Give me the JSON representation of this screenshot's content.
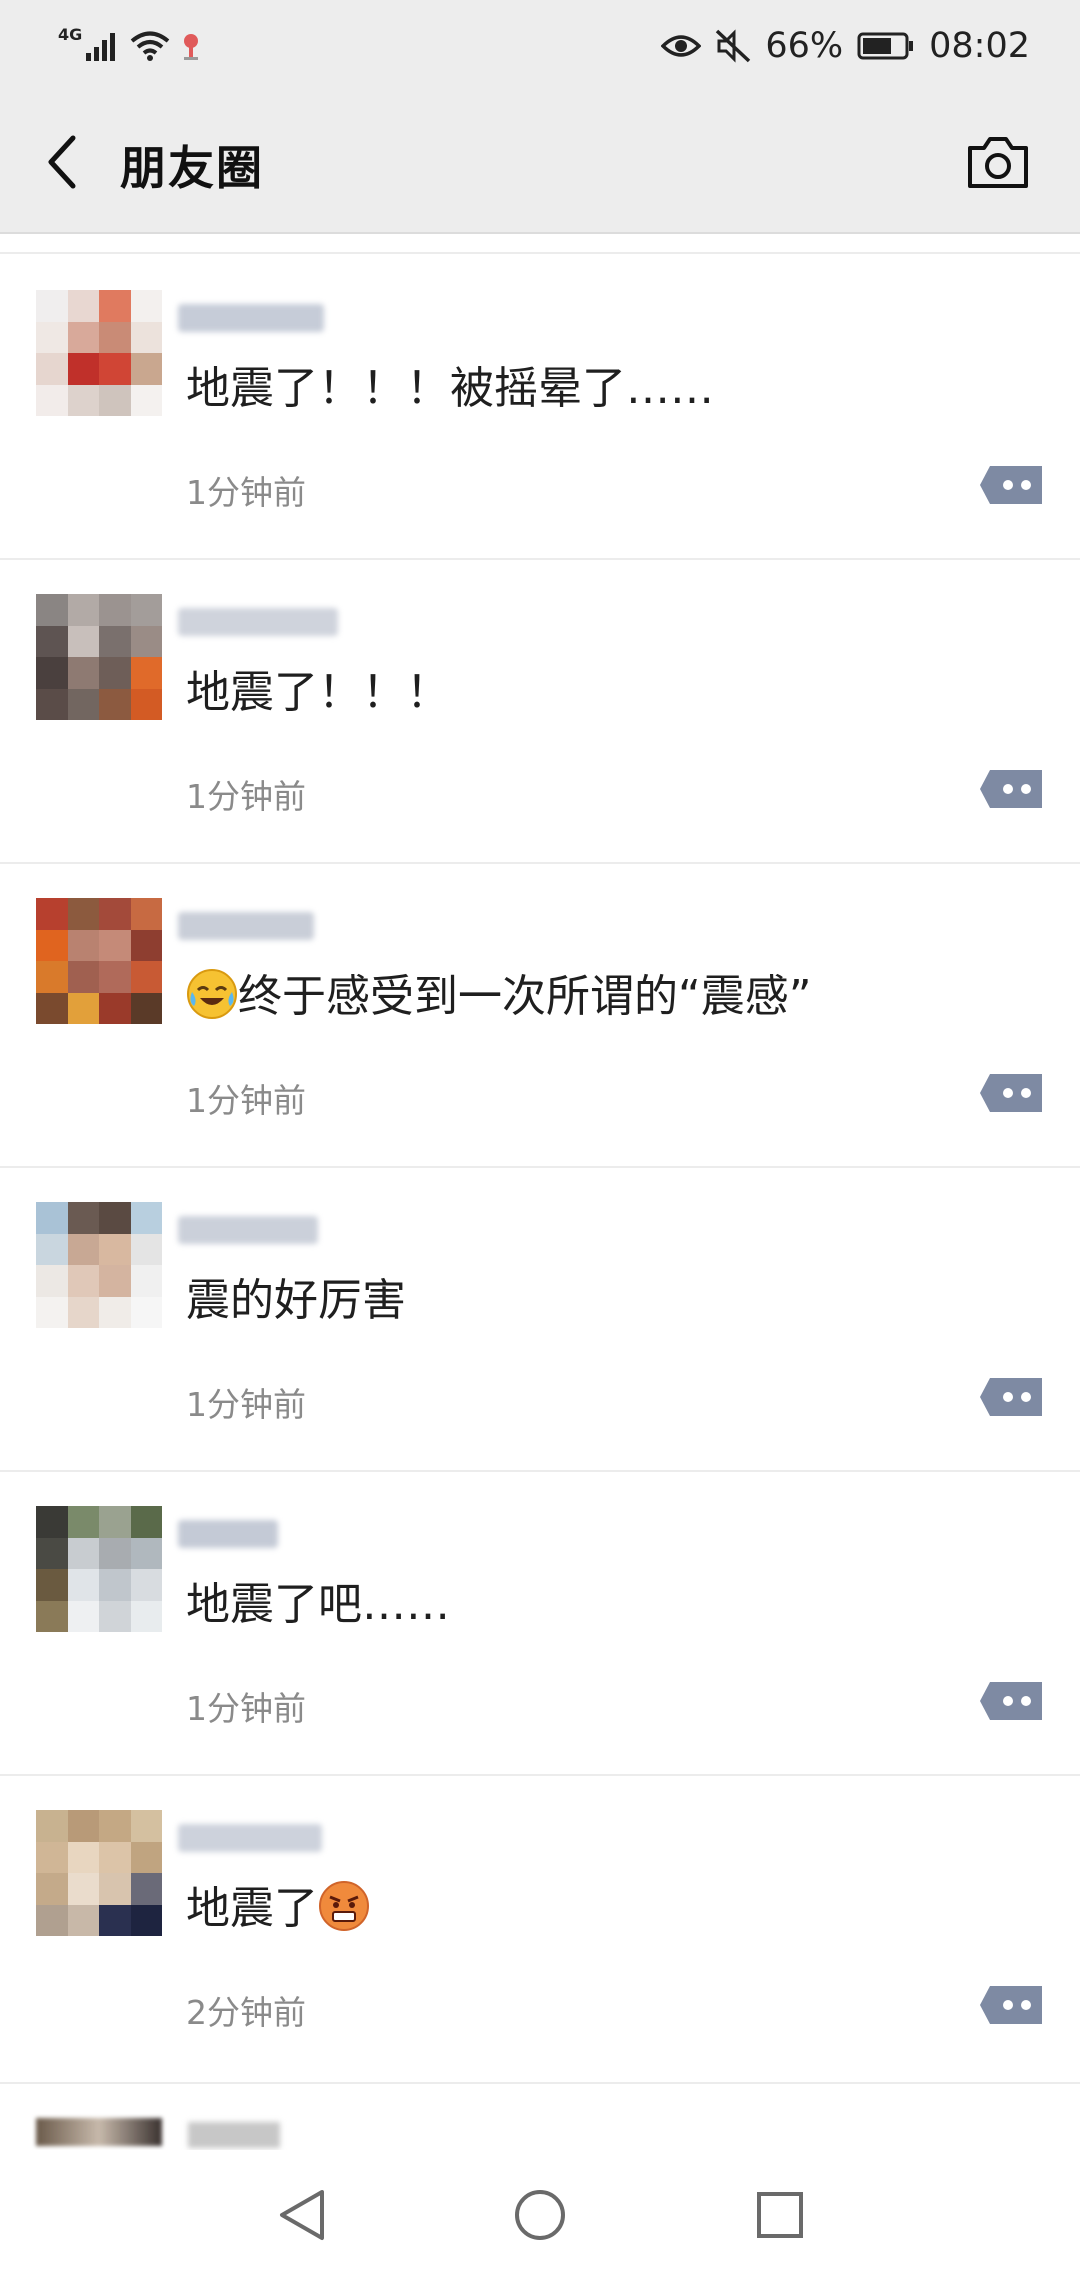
{
  "status_bar": {
    "network": "4G",
    "battery": "66%",
    "time": "08:02",
    "icons": [
      "signal-icon",
      "wifi-icon",
      "location-icon",
      "eye-icon",
      "mute-icon",
      "battery-icon"
    ]
  },
  "header": {
    "title": "朋友圈",
    "back_icon": "back-arrow-icon",
    "camera_icon": "camera-icon"
  },
  "posts": [
    {
      "text": "地震了！！！被摇晕了……",
      "time": "1分钟前"
    },
    {
      "text": "地震了！！！",
      "time": "1分钟前"
    },
    {
      "emoji": "crying-laughing-emoji",
      "text": "终于感受到一次所谓的“震感”",
      "time": "1分钟前"
    },
    {
      "text": "震的好厉害",
      "time": "1分钟前"
    },
    {
      "text": "地震了吧……",
      "time": "1分钟前"
    },
    {
      "text": "地震了",
      "emoji": "angry-face-emoji",
      "time": "2分钟前"
    }
  ],
  "colors": {
    "header_bg": "#ededed",
    "more_button": "#7e8aa3",
    "time_text": "#8a8a8a"
  },
  "nav_bar": {
    "icons": [
      "nav-back-icon",
      "nav-home-icon",
      "nav-recents-icon"
    ]
  }
}
